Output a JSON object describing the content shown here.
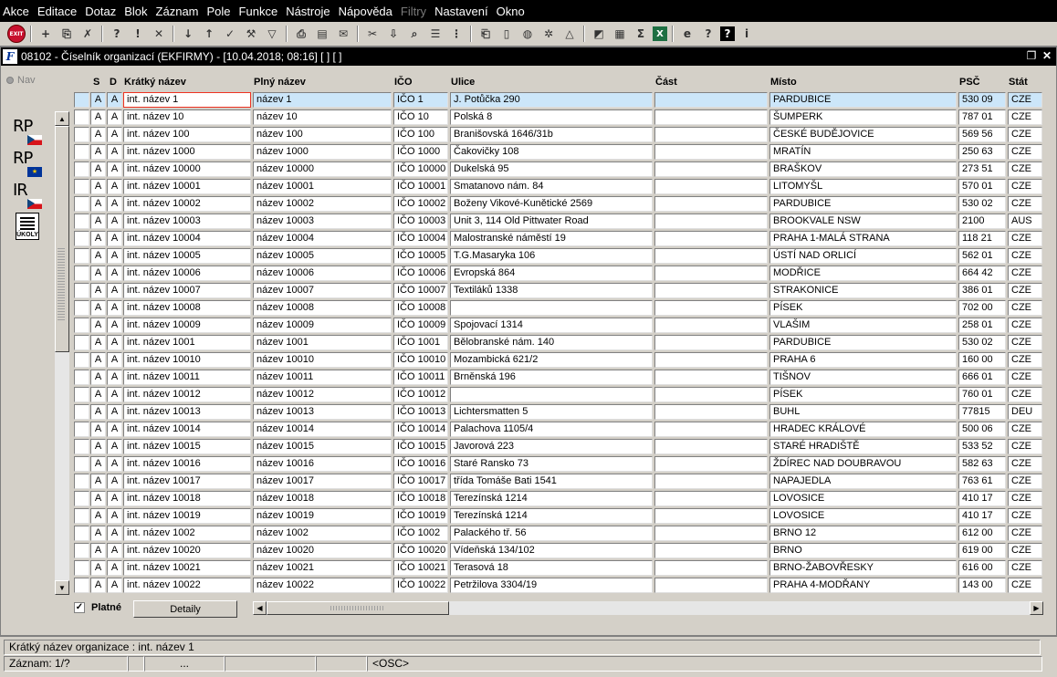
{
  "menu": [
    "Akce",
    "Editace",
    "Dotaz",
    "Blok",
    "Záznam",
    "Pole",
    "Funkce",
    "Nástroje",
    "Nápověda",
    "Filtry",
    "Nastavení",
    "Okno"
  ],
  "toolbar_icons": [
    "exit-icon",
    "insert-record-icon",
    "duplicate-record-icon",
    "clear-record-icon",
    "enter-query-icon",
    "execute-query-icon",
    "cancel-query-icon",
    "sort-ascending-icon",
    "sort-descending-icon",
    "save-icon",
    "tools-icon",
    "filter-icon",
    "print-icon",
    "print-preview-icon",
    "send-mail-icon",
    "cut-icon",
    "paste-icon",
    "find-icon",
    "list-icon",
    "tree-icon",
    "attachment-icon",
    "document-icon",
    "globe-icon",
    "settings-icon",
    "warning-icon",
    "chart-icon",
    "report-icon",
    "sum-icon",
    "excel-icon",
    "browser-icon",
    "help-query-icon",
    "help-icon",
    "info-icon"
  ],
  "window": {
    "title": "08102 - Číselník organizací (EKFIRMY) - [10.04.2018; 08:16] [ ] [ ]",
    "app_icon": "F"
  },
  "nav_label": "Nav",
  "side_buttons": [
    {
      "label": "RP",
      "flag": "cz"
    },
    {
      "label": "RP",
      "flag": "eu"
    },
    {
      "label": "IR",
      "flag": "cz"
    },
    {
      "label": "ÚKOLY",
      "flag": ""
    }
  ],
  "grid": {
    "headers": [
      "",
      "S",
      "D",
      "Krátký název",
      "Plný název",
      "IČO",
      "Ulice",
      "Část",
      "Místo",
      "PSČ",
      "Stát"
    ],
    "rows": [
      [
        "",
        "A",
        "A",
        "int. název 1",
        "název 1",
        "IČO 1",
        "J. Potůčka 290",
        "",
        "PARDUBICE",
        "530 09",
        "CZE"
      ],
      [
        "",
        "A",
        "A",
        "int. název 10",
        "název 10",
        "IČO 10",
        "Polská 8",
        "",
        "ŠUMPERK",
        "787 01",
        "CZE"
      ],
      [
        "",
        "A",
        "A",
        "int. název 100",
        "název 100",
        "IČO 100",
        "Branišovská 1646/31b",
        "",
        "ČESKÉ BUDĚJOVICE",
        "569 56",
        "CZE"
      ],
      [
        "",
        "A",
        "A",
        "int. název 1000",
        "název 1000",
        "IČO 1000",
        "Čakovičky 108",
        "",
        "MRATÍN",
        "250 63",
        "CZE"
      ],
      [
        "",
        "A",
        "A",
        "int. název 10000",
        "název 10000",
        "IČO 10000",
        "Dukelská 95",
        "",
        "BRAŠKOV",
        "273 51",
        "CZE"
      ],
      [
        "",
        "A",
        "A",
        "int. název 10001",
        "název 10001",
        "IČO 10001",
        "Smatanovo nám. 84",
        "",
        "LITOMYŠL",
        "570 01",
        "CZE"
      ],
      [
        "",
        "A",
        "A",
        "int. název 10002",
        "název 10002",
        "IČO 10002",
        "Boženy Vikové-Kunětické 2569",
        "",
        "PARDUBICE",
        "530 02",
        "CZE"
      ],
      [
        "",
        "A",
        "A",
        "int. název 10003",
        "název 10003",
        "IČO 10003",
        "Unit 3, 114 Old Pittwater Road",
        "",
        "BROOKVALE NSW",
        "2100",
        "AUS"
      ],
      [
        "",
        "A",
        "A",
        "int. název 10004",
        "název 10004",
        "IČO 10004",
        "Malostranské náměstí 19",
        "",
        "PRAHA 1-MALÁ STRANA",
        "118 21",
        "CZE"
      ],
      [
        "",
        "A",
        "A",
        "int. název 10005",
        "název 10005",
        "IČO 10005",
        "T.G.Masaryka 106",
        "",
        "ÚSTÍ NAD ORLICÍ",
        "562 01",
        "CZE"
      ],
      [
        "",
        "A",
        "A",
        "int. název 10006",
        "název 10006",
        "IČO 10006",
        "Evropská 864",
        "",
        "MODŘICE",
        "664 42",
        "CZE"
      ],
      [
        "",
        "A",
        "A",
        "int. název 10007",
        "název 10007",
        "IČO 10007",
        "Textiláků 1338",
        "",
        "STRAKONICE",
        "386 01",
        "CZE"
      ],
      [
        "",
        "A",
        "A",
        "int. název 10008",
        "název 10008",
        "IČO 10008",
        "",
        "",
        "PÍSEK",
        "702 00",
        "CZE"
      ],
      [
        "",
        "A",
        "A",
        "int. název 10009",
        "název 10009",
        "IČO 10009",
        "Spojovací 1314",
        "",
        "VLAŠIM",
        "258 01",
        "CZE"
      ],
      [
        "",
        "A",
        "A",
        "int. název 1001",
        "název 1001",
        "IČO 1001",
        "Bělobranské nám. 140",
        "",
        "PARDUBICE",
        "530 02",
        "CZE"
      ],
      [
        "",
        "A",
        "A",
        "int. název 10010",
        "název 10010",
        "IČO 10010",
        "Mozambická 621/2",
        "",
        "PRAHA 6",
        "160 00",
        "CZE"
      ],
      [
        "",
        "A",
        "A",
        "int. název 10011",
        "název 10011",
        "IČO 10011",
        "Brněnská 196",
        "",
        "TIŠNOV",
        "666 01",
        "CZE"
      ],
      [
        "",
        "A",
        "A",
        "int. název 10012",
        "název 10012",
        "IČO 10012",
        "",
        "",
        "PÍSEK",
        "760 01",
        "CZE"
      ],
      [
        "",
        "A",
        "A",
        "int. název 10013",
        "název 10013",
        "IČO 10013",
        "Lichtersmatten 5",
        "",
        "BUHL",
        "77815",
        "DEU"
      ],
      [
        "",
        "A",
        "A",
        "int. název 10014",
        "název 10014",
        "IČO 10014",
        "Palachova 1105/4",
        "",
        "HRADEC KRÁLOVÉ",
        "500 06",
        "CZE"
      ],
      [
        "",
        "A",
        "A",
        "int. název 10015",
        "název 10015",
        "IČO 10015",
        "Javorová 223",
        "",
        "STARÉ HRADIŠTĚ",
        "533 52",
        "CZE"
      ],
      [
        "",
        "A",
        "A",
        "int. název 10016",
        "název 10016",
        "IČO 10016",
        "Staré Ransko 73",
        "",
        "ŽDÍREC NAD DOUBRAVOU",
        "582 63",
        "CZE"
      ],
      [
        "",
        "A",
        "A",
        "int. název 10017",
        "název 10017",
        "IČO 10017",
        "třída Tomáše Bati 1541",
        "",
        "NAPAJEDLA",
        "763 61",
        "CZE"
      ],
      [
        "",
        "A",
        "A",
        "int. název 10018",
        "název 10018",
        "IČO 10018",
        "Terezínská 1214",
        "",
        "LOVOSICE",
        "410 17",
        "CZE"
      ],
      [
        "",
        "A",
        "A",
        "int. název 10019",
        "název 10019",
        "IČO 10019",
        "Terezínská 1214",
        "",
        "LOVOSICE",
        "410 17",
        "CZE"
      ],
      [
        "",
        "A",
        "A",
        "int. název 1002",
        "název 1002",
        "IČO 1002",
        "Palackého tř. 56",
        "",
        "BRNO 12",
        "612 00",
        "CZE"
      ],
      [
        "",
        "A",
        "A",
        "int. název 10020",
        "název 10020",
        "IČO 10020",
        "Vídeňská 134/102",
        "",
        "BRNO",
        "619 00",
        "CZE"
      ],
      [
        "",
        "A",
        "A",
        "int. název 10021",
        "název 10021",
        "IČO 10021",
        "Terasová 18",
        "",
        "BRNO-ŽABOVŘESKY",
        "616 00",
        "CZE"
      ],
      [
        "",
        "A",
        "A",
        "int. název 10022",
        "název 10022",
        "IČO 10022",
        "Petržilova 3304/19",
        "",
        "PRAHA 4-MODŘANY",
        "143 00",
        "CZE"
      ]
    ],
    "selected_row": 0
  },
  "platne": {
    "label": "Platné",
    "checked": true
  },
  "detaily_label": "Detaily",
  "status": {
    "message": "Krátký název organizace : int. název 1",
    "record": "Záznam: 1/?",
    "seg3": "...",
    "mode": "<OSC>"
  }
}
